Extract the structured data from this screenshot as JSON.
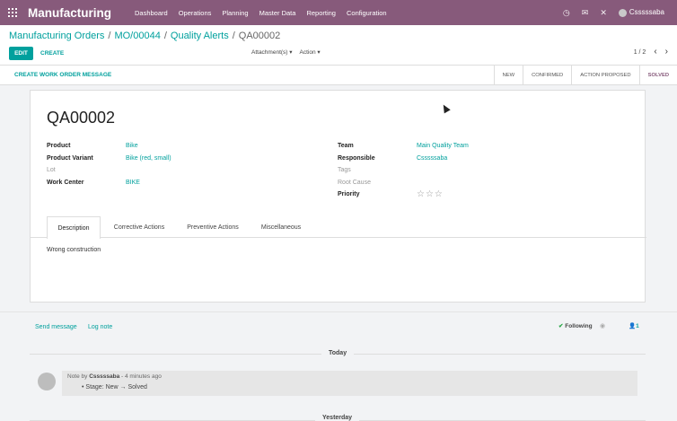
{
  "topbar": {
    "app_name": "Manufacturing",
    "menu": [
      "Dashboard",
      "Operations",
      "Planning",
      "Master Data",
      "Reporting",
      "Configuration"
    ],
    "user": "Csssssaba",
    "icons": [
      "clock-icon",
      "chat-icon",
      "close-icon"
    ]
  },
  "breadcrumb": [
    "Manufacturing Orders",
    "MO/00044",
    "Quality Alerts",
    "QA00002"
  ],
  "buttons": {
    "edit": "EDIT",
    "create": "CREATE",
    "attachments": "Attachment(s)",
    "action": "Action",
    "create_wo_msg": "CREATE WORK ORDER MESSAGE"
  },
  "pager": {
    "value": "1 / 2"
  },
  "stages": [
    {
      "label": "NEW",
      "active": false
    },
    {
      "label": "CONFIRMED",
      "active": false
    },
    {
      "label": "ACTION PROPOSED",
      "active": false
    },
    {
      "label": "SOLVED",
      "active": true
    }
  ],
  "record": {
    "name": "QA00002",
    "left_fields": [
      {
        "label": "Product",
        "value": "Bike",
        "muted": false
      },
      {
        "label": "Product Variant",
        "value": "Bike (red, small)",
        "muted": false
      },
      {
        "label": "Lot",
        "value": "",
        "muted": true
      },
      {
        "label": "Work Center",
        "value": "BIKE",
        "muted": false
      }
    ],
    "right_fields": [
      {
        "label": "Team",
        "value": "Main Quality Team",
        "muted": false
      },
      {
        "label": "Responsible",
        "value": "Csssssaba",
        "muted": false
      },
      {
        "label": "Tags",
        "value": "",
        "muted": true
      },
      {
        "label": "Root Cause",
        "value": "",
        "muted": true
      },
      {
        "label": "Priority",
        "value": "☆☆☆",
        "muted": false
      }
    ],
    "priority_stars": 0
  },
  "tabs": [
    {
      "label": "Description",
      "active": true
    },
    {
      "label": "Corrective Actions",
      "active": false
    },
    {
      "label": "Preventive Actions",
      "active": false
    },
    {
      "label": "Miscellaneous",
      "active": false
    }
  ],
  "description": "Wrong construction",
  "chatter": {
    "send_message": "Send message",
    "log_note": "Log note",
    "following": "Following",
    "followers_count": "1",
    "today": "Today",
    "yesterday": "Yesterday",
    "message": {
      "prefix": "Note by",
      "author": "Csssssaba",
      "time": "- 4 minutes ago",
      "body": "Stage: New → Solved"
    }
  }
}
